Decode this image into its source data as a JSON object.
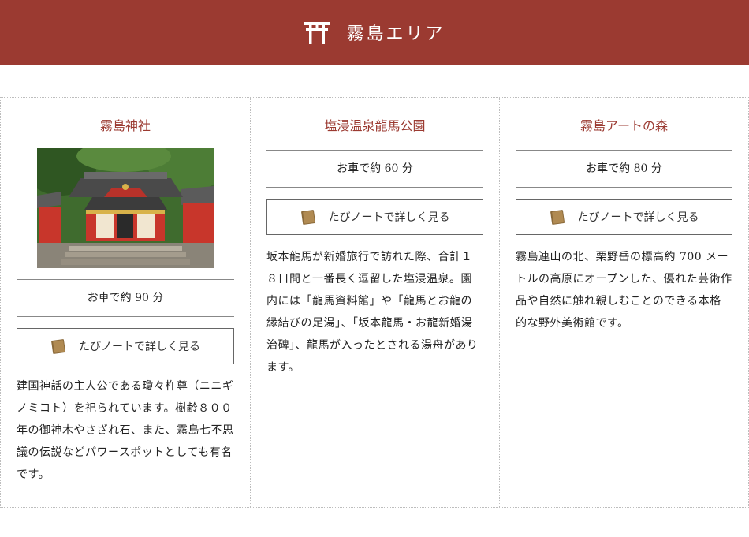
{
  "header": {
    "title": "霧島エリア",
    "icon": "torii-icon",
    "color": "#9b3a31"
  },
  "spots": [
    {
      "name": "霧島神社",
      "has_image": true,
      "access": "お車で約 90 分",
      "button_label": "たびノートで詳しく見る",
      "description": "建国神話の主人公である瓊々杵尊（ニニギノミコト）を祀られています。樹齢８００年の御神木やさざれ石、また、霧島七不思議の伝説などパワースポットとしても有名です。"
    },
    {
      "name": "塩浸温泉龍馬公園",
      "has_image": false,
      "access": "お車で約 60 分",
      "button_label": "たびノートで詳しく見る",
      "description": "坂本龍馬が新婚旅行で訪れた際、合計１８日間と一番長く逗留した塩浸温泉。園内には「龍馬資料館」や「龍馬とお龍の縁結びの足湯」、「坂本龍馬・お龍新婚湯治碑」、龍馬が入ったとされる湯舟があります。"
    },
    {
      "name": "霧島アートの森",
      "has_image": false,
      "access": "お車で約 80 分",
      "button_label": "たびノートで詳しく見る",
      "description": "霧島連山の北、栗野岳の標高約 700 メートルの高原にオープンした、優れた芸術作品や自然に触れ親しむことのできる本格的な野外美術館です。"
    }
  ]
}
